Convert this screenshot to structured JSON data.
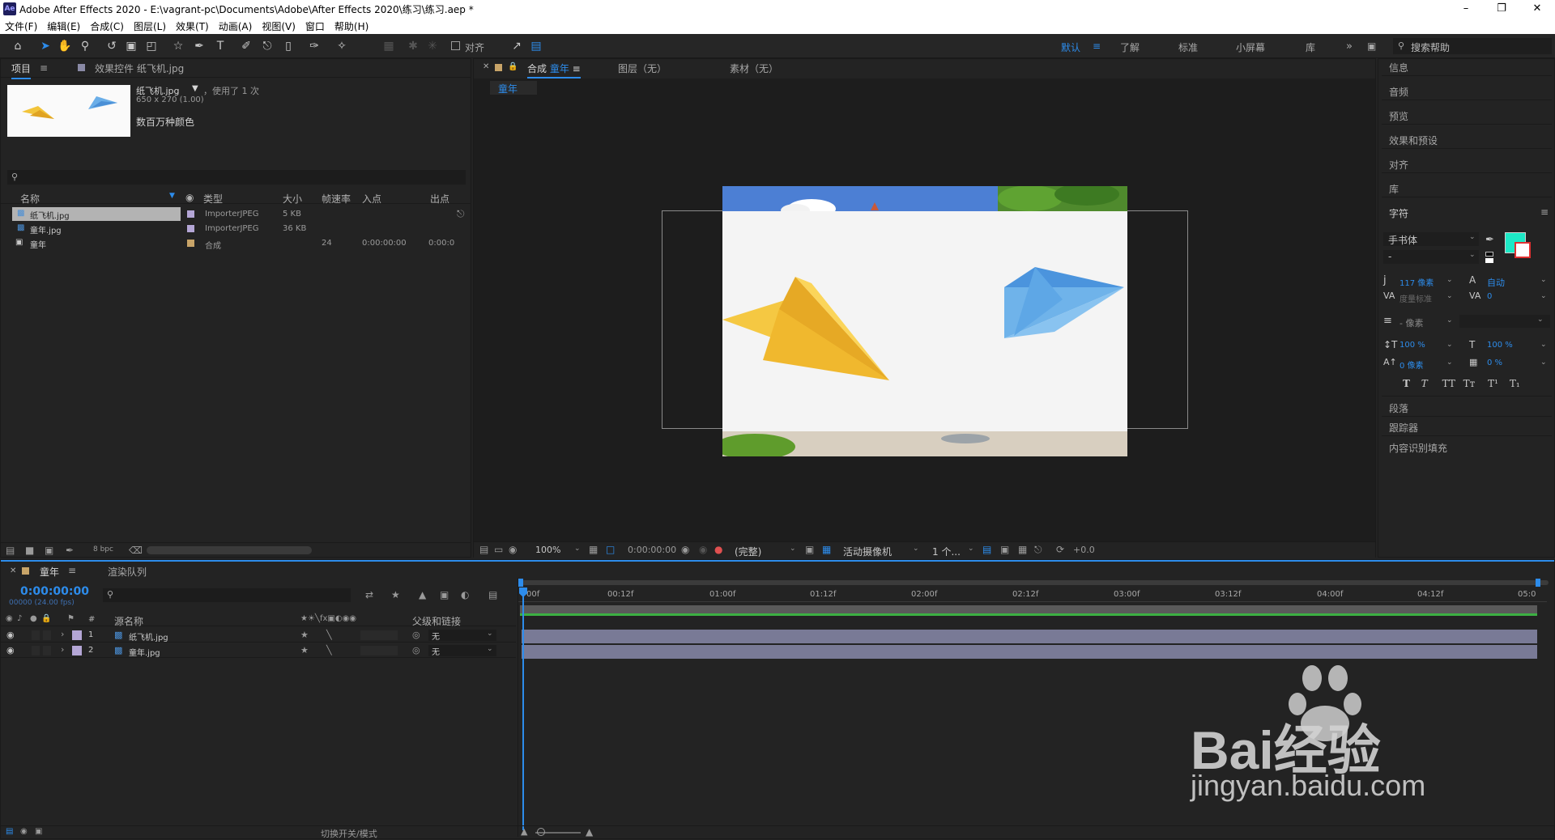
{
  "window": {
    "title": "Adobe After Effects 2020 - E:\\vagrant-pc\\Documents\\Adobe\\After Effects 2020\\练习\\练习.aep *",
    "logo": "Ae"
  },
  "menu": [
    "文件(F)",
    "编辑(E)",
    "合成(C)",
    "图层(L)",
    "效果(T)",
    "动画(A)",
    "视图(V)",
    "窗口",
    "帮助(H)"
  ],
  "toolbar": {
    "align_label": "对齐",
    "workspaces": [
      "默认",
      "了解",
      "标准",
      "小屏幕",
      "库"
    ],
    "search_placeholder": "搜索帮助"
  },
  "project_panel": {
    "tab_project": "项目",
    "tab_effects": "效果控件 纸飞机.jpg",
    "file_name": "纸飞机.jpg",
    "used": "，使用了 1 次",
    "dims": "650 x 270 (1.00)",
    "colors": "数百万种颜色",
    "columns": [
      "名称",
      "类型",
      "大小",
      "帧速率",
      "入点",
      "出点"
    ],
    "items": [
      {
        "name": "纸飞机.jpg",
        "type": "ImporterJPEG",
        "size": "5 KB",
        "fps": "",
        "in": "",
        "out": ""
      },
      {
        "name": "童年.jpg",
        "type": "ImporterJPEG",
        "size": "36 KB",
        "fps": "",
        "in": "",
        "out": ""
      },
      {
        "name": "童年",
        "type": "合成",
        "size": "",
        "fps": "24",
        "in": "0:00:00:00",
        "out": "0:00:0"
      }
    ],
    "bpc": "8 bpc"
  },
  "comp_panel": {
    "tab_comp_prefix": "合成",
    "tab_comp_name": "童年",
    "tab_layer": "图层（无）",
    "tab_footage": "素材（无）",
    "breadcrumb": "童年",
    "footer": {
      "zoom": "100%",
      "time": "0:00:00:00",
      "resolution": "(完整)",
      "camera": "活动摄像机",
      "views": "1 个...",
      "exposure": "+0.0"
    }
  },
  "right_panel": {
    "items_top": [
      "信息",
      "音频",
      "预览",
      "效果和预设",
      "对齐",
      "库"
    ],
    "character_title": "字符",
    "font": "手书体",
    "font_style": "-",
    "font_size": "117 像素",
    "leading": "自动",
    "kerning": "度量标准",
    "tracking": "0",
    "stroke_width": "- 像素",
    "vscale": "100 %",
    "hscale": "100 %",
    "baseline": "0 像素",
    "tsume": "0 %",
    "fill_color": "#1de9c6",
    "items_bottom": [
      "段落",
      "跟踪器",
      "内容识别填充"
    ]
  },
  "timeline": {
    "tab_comp": "童年",
    "tab_render": "渲染队列",
    "timecode": "0:00:00:00",
    "fps_note": "00000 (24.00 fps)",
    "columns": {
      "num": "#",
      "source": "源名称",
      "parent": "父级和链接"
    },
    "layers": [
      {
        "num": "1",
        "name": "纸飞机.jpg",
        "parent": "无"
      },
      {
        "num": "2",
        "name": "童年.jpg",
        "parent": "无"
      }
    ],
    "ruler": [
      "00f",
      "00:12f",
      "01:00f",
      "01:12f",
      "02:00f",
      "02:12f",
      "03:00f",
      "03:12f",
      "04:00f",
      "04:12f",
      "05:0"
    ],
    "footer_toggle": "切换开关/模式"
  },
  "watermark": {
    "text": "Bai经验",
    "url": "jingyan.baidu.com"
  }
}
